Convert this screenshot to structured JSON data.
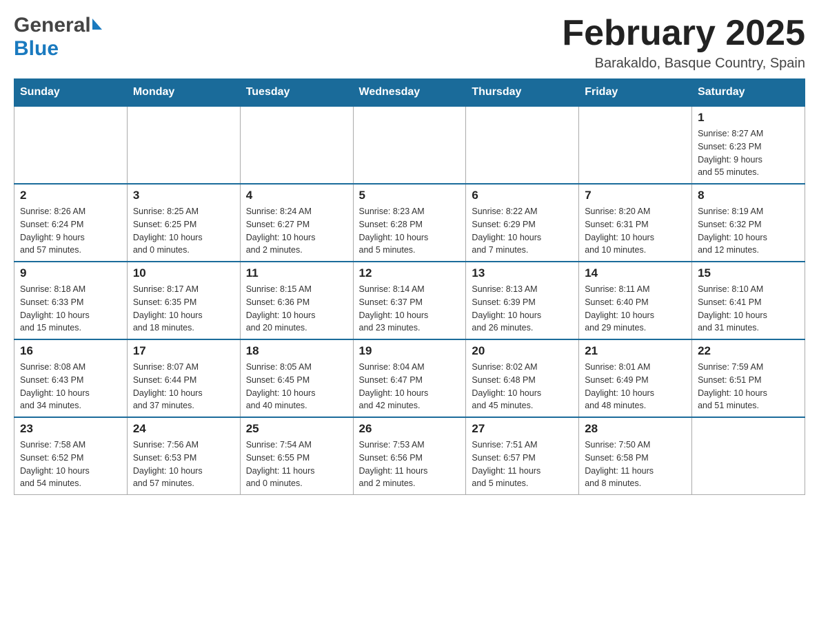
{
  "header": {
    "logo_general": "General",
    "logo_blue": "Blue",
    "month_title": "February 2025",
    "location": "Barakaldo, Basque Country, Spain"
  },
  "calendar": {
    "days_of_week": [
      "Sunday",
      "Monday",
      "Tuesday",
      "Wednesday",
      "Thursday",
      "Friday",
      "Saturday"
    ],
    "weeks": [
      {
        "days": [
          {
            "number": "",
            "info": ""
          },
          {
            "number": "",
            "info": ""
          },
          {
            "number": "",
            "info": ""
          },
          {
            "number": "",
            "info": ""
          },
          {
            "number": "",
            "info": ""
          },
          {
            "number": "",
            "info": ""
          },
          {
            "number": "1",
            "info": "Sunrise: 8:27 AM\nSunset: 6:23 PM\nDaylight: 9 hours\nand 55 minutes."
          }
        ]
      },
      {
        "days": [
          {
            "number": "2",
            "info": "Sunrise: 8:26 AM\nSunset: 6:24 PM\nDaylight: 9 hours\nand 57 minutes."
          },
          {
            "number": "3",
            "info": "Sunrise: 8:25 AM\nSunset: 6:25 PM\nDaylight: 10 hours\nand 0 minutes."
          },
          {
            "number": "4",
            "info": "Sunrise: 8:24 AM\nSunset: 6:27 PM\nDaylight: 10 hours\nand 2 minutes."
          },
          {
            "number": "5",
            "info": "Sunrise: 8:23 AM\nSunset: 6:28 PM\nDaylight: 10 hours\nand 5 minutes."
          },
          {
            "number": "6",
            "info": "Sunrise: 8:22 AM\nSunset: 6:29 PM\nDaylight: 10 hours\nand 7 minutes."
          },
          {
            "number": "7",
            "info": "Sunrise: 8:20 AM\nSunset: 6:31 PM\nDaylight: 10 hours\nand 10 minutes."
          },
          {
            "number": "8",
            "info": "Sunrise: 8:19 AM\nSunset: 6:32 PM\nDaylight: 10 hours\nand 12 minutes."
          }
        ]
      },
      {
        "days": [
          {
            "number": "9",
            "info": "Sunrise: 8:18 AM\nSunset: 6:33 PM\nDaylight: 10 hours\nand 15 minutes."
          },
          {
            "number": "10",
            "info": "Sunrise: 8:17 AM\nSunset: 6:35 PM\nDaylight: 10 hours\nand 18 minutes."
          },
          {
            "number": "11",
            "info": "Sunrise: 8:15 AM\nSunset: 6:36 PM\nDaylight: 10 hours\nand 20 minutes."
          },
          {
            "number": "12",
            "info": "Sunrise: 8:14 AM\nSunset: 6:37 PM\nDaylight: 10 hours\nand 23 minutes."
          },
          {
            "number": "13",
            "info": "Sunrise: 8:13 AM\nSunset: 6:39 PM\nDaylight: 10 hours\nand 26 minutes."
          },
          {
            "number": "14",
            "info": "Sunrise: 8:11 AM\nSunset: 6:40 PM\nDaylight: 10 hours\nand 29 minutes."
          },
          {
            "number": "15",
            "info": "Sunrise: 8:10 AM\nSunset: 6:41 PM\nDaylight: 10 hours\nand 31 minutes."
          }
        ]
      },
      {
        "days": [
          {
            "number": "16",
            "info": "Sunrise: 8:08 AM\nSunset: 6:43 PM\nDaylight: 10 hours\nand 34 minutes."
          },
          {
            "number": "17",
            "info": "Sunrise: 8:07 AM\nSunset: 6:44 PM\nDaylight: 10 hours\nand 37 minutes."
          },
          {
            "number": "18",
            "info": "Sunrise: 8:05 AM\nSunset: 6:45 PM\nDaylight: 10 hours\nand 40 minutes."
          },
          {
            "number": "19",
            "info": "Sunrise: 8:04 AM\nSunset: 6:47 PM\nDaylight: 10 hours\nand 42 minutes."
          },
          {
            "number": "20",
            "info": "Sunrise: 8:02 AM\nSunset: 6:48 PM\nDaylight: 10 hours\nand 45 minutes."
          },
          {
            "number": "21",
            "info": "Sunrise: 8:01 AM\nSunset: 6:49 PM\nDaylight: 10 hours\nand 48 minutes."
          },
          {
            "number": "22",
            "info": "Sunrise: 7:59 AM\nSunset: 6:51 PM\nDaylight: 10 hours\nand 51 minutes."
          }
        ]
      },
      {
        "days": [
          {
            "number": "23",
            "info": "Sunrise: 7:58 AM\nSunset: 6:52 PM\nDaylight: 10 hours\nand 54 minutes."
          },
          {
            "number": "24",
            "info": "Sunrise: 7:56 AM\nSunset: 6:53 PM\nDaylight: 10 hours\nand 57 minutes."
          },
          {
            "number": "25",
            "info": "Sunrise: 7:54 AM\nSunset: 6:55 PM\nDaylight: 11 hours\nand 0 minutes."
          },
          {
            "number": "26",
            "info": "Sunrise: 7:53 AM\nSunset: 6:56 PM\nDaylight: 11 hours\nand 2 minutes."
          },
          {
            "number": "27",
            "info": "Sunrise: 7:51 AM\nSunset: 6:57 PM\nDaylight: 11 hours\nand 5 minutes."
          },
          {
            "number": "28",
            "info": "Sunrise: 7:50 AM\nSunset: 6:58 PM\nDaylight: 11 hours\nand 8 minutes."
          },
          {
            "number": "",
            "info": ""
          }
        ]
      }
    ]
  }
}
